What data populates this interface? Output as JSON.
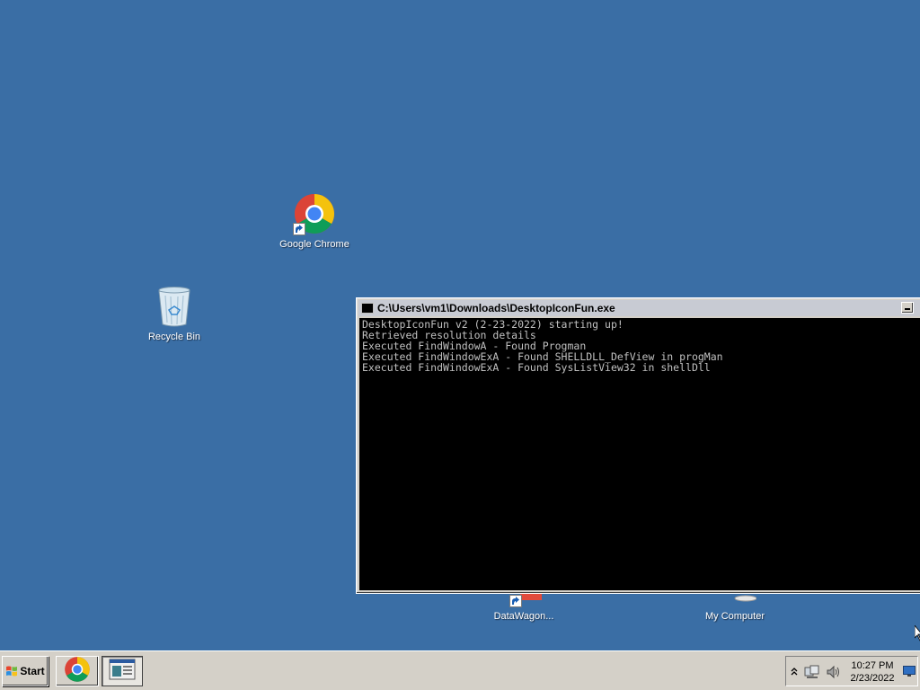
{
  "desktop": {
    "background": "#3a6ea5",
    "icons": {
      "chrome": {
        "label": "Google Chrome"
      },
      "recycle_bin": {
        "label": "Recycle Bin"
      },
      "datawagon": {
        "label": "DataWagon..."
      },
      "my_computer": {
        "label": "My Computer"
      }
    }
  },
  "console": {
    "title": "C:\\Users\\vm1\\Downloads\\DesktopIconFun.exe",
    "lines": [
      "DesktopIconFun v2 (2-23-2022) starting up!",
      "Retrieved resolution details",
      "Executed FindWindowA - Found Progman",
      "Executed FindWindowExA - Found SHELLDLL_DefView in progMan",
      "Executed FindWindowExA - Found SysListView32 in shellDll"
    ]
  },
  "taskbar": {
    "start_label": "Start",
    "clock": {
      "time": "10:27 PM",
      "date": "2/23/2022"
    }
  }
}
